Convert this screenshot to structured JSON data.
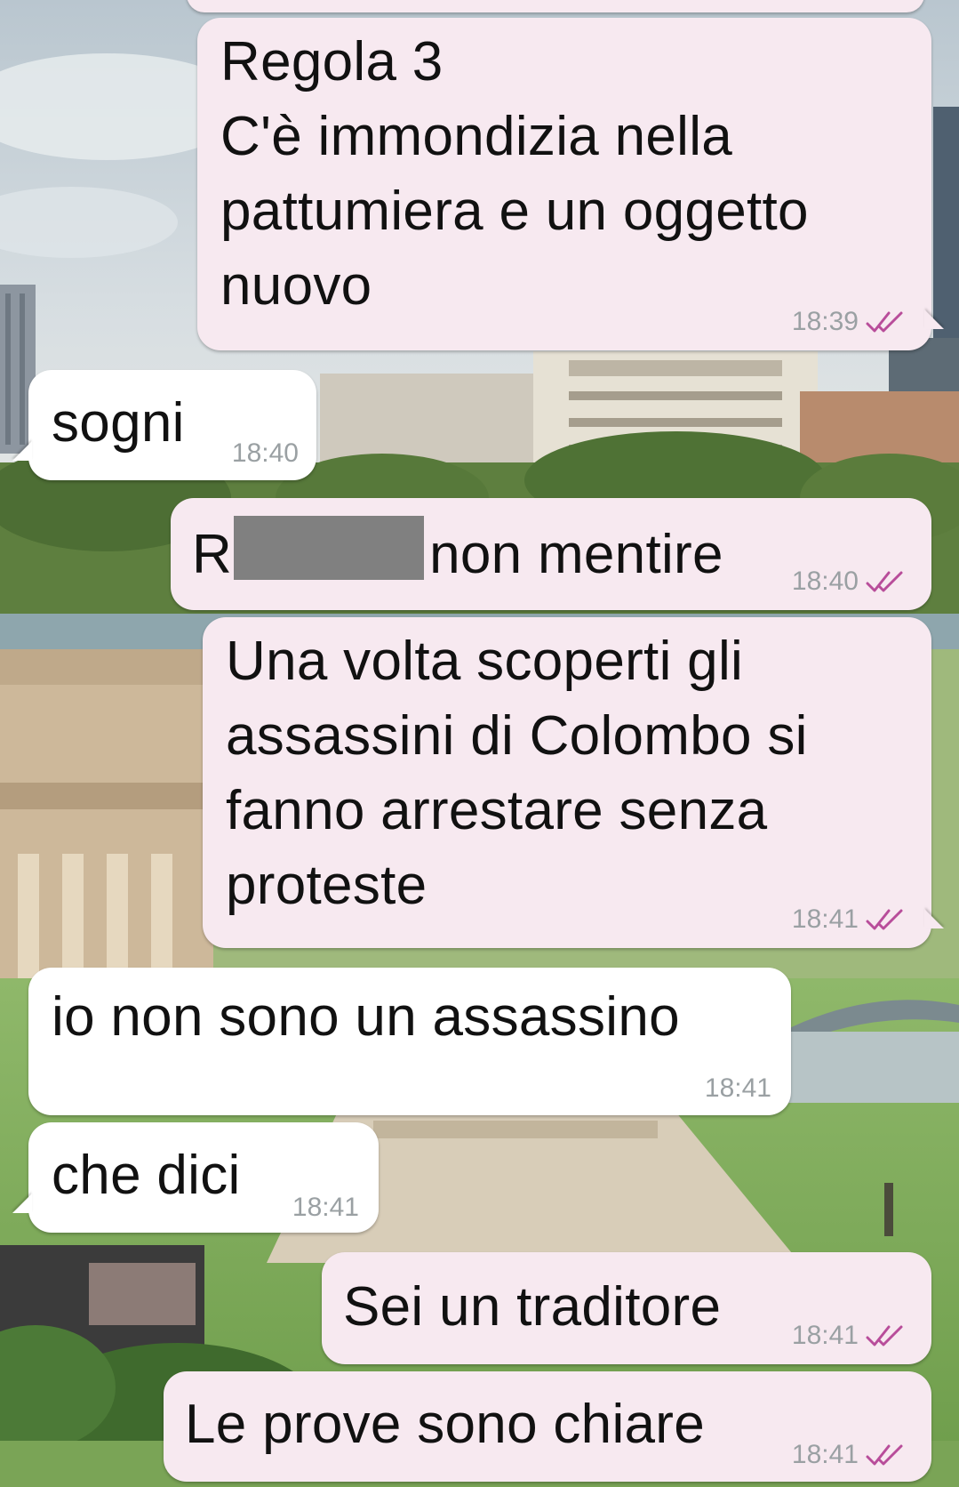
{
  "messages": [
    {
      "direction": "outgoing",
      "text": "Regola 3\nC'è immondizia nella\npattumiera e un oggetto\nnuovo",
      "time": "18:39",
      "status_icon": "double-check-icon"
    },
    {
      "direction": "incoming",
      "text": "sogni",
      "time": "18:40"
    },
    {
      "direction": "outgoing",
      "text_before": "R",
      "text_after": "non mentire",
      "redacted": true,
      "time": "18:40",
      "status_icon": "double-check-icon"
    },
    {
      "direction": "outgoing",
      "text": "Una volta scoperti gli\nassassini di Colombo si\nfanno arrestare senza\nproteste",
      "time": "18:41",
      "status_icon": "double-check-icon"
    },
    {
      "direction": "incoming",
      "text": "io non sono un assassino",
      "time": "18:41"
    },
    {
      "direction": "incoming",
      "text": "che dici",
      "time": "18:41"
    },
    {
      "direction": "outgoing",
      "text": "Sei un traditore",
      "time": "18:41",
      "status_icon": "double-check-icon"
    },
    {
      "direction": "outgoing",
      "text": "Le prove sono chiare",
      "time": "18:41",
      "status_icon": "double-check-icon"
    }
  ],
  "colors": {
    "outgoing_bubble": "#f7e9f0",
    "incoming_bubble": "#ffffff",
    "timestamp": "#9aa0a3",
    "read_ticks": "#b84d9a",
    "redaction": "#808080"
  }
}
